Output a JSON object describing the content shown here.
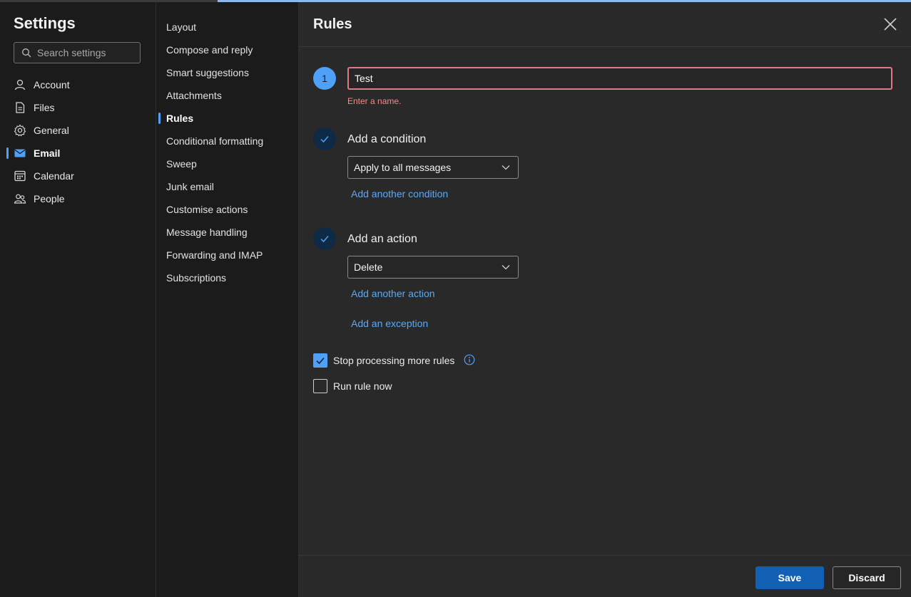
{
  "settings": {
    "title": "Settings",
    "search_placeholder": "Search settings"
  },
  "nav_main": [
    {
      "label": "Account",
      "icon": "person-icon"
    },
    {
      "label": "Files",
      "icon": "file-icon"
    },
    {
      "label": "General",
      "icon": "gear-icon"
    },
    {
      "label": "Email",
      "icon": "mail-icon",
      "active": true
    },
    {
      "label": "Calendar",
      "icon": "calendar-icon"
    },
    {
      "label": "People",
      "icon": "people-icon"
    }
  ],
  "nav_email": [
    "Layout",
    "Compose and reply",
    "Smart suggestions",
    "Attachments",
    "Rules",
    "Conditional formatting",
    "Sweep",
    "Junk email",
    "Customise actions",
    "Message handling",
    "Forwarding and IMAP",
    "Subscriptions"
  ],
  "nav_email_active": "Rules",
  "rules": {
    "title": "Rules",
    "step_number": "1",
    "name_value": "Test",
    "name_error": "Enter a name.",
    "condition": {
      "title": "Add a condition",
      "selected": "Apply to all messages",
      "add_link": "Add another condition"
    },
    "action": {
      "title": "Add an action",
      "selected": "Delete",
      "add_link": "Add another action"
    },
    "exception_link": "Add an exception",
    "stop_processing": {
      "label": "Stop processing more rules",
      "checked": true
    },
    "run_now": {
      "label": "Run rule now",
      "checked": false
    }
  },
  "footer": {
    "save": "Save",
    "discard": "Discard"
  },
  "colors": {
    "accent": "#4fa0f7",
    "error": "#e07a84",
    "link": "#5ba9f5",
    "primary_button": "#1160b4"
  }
}
